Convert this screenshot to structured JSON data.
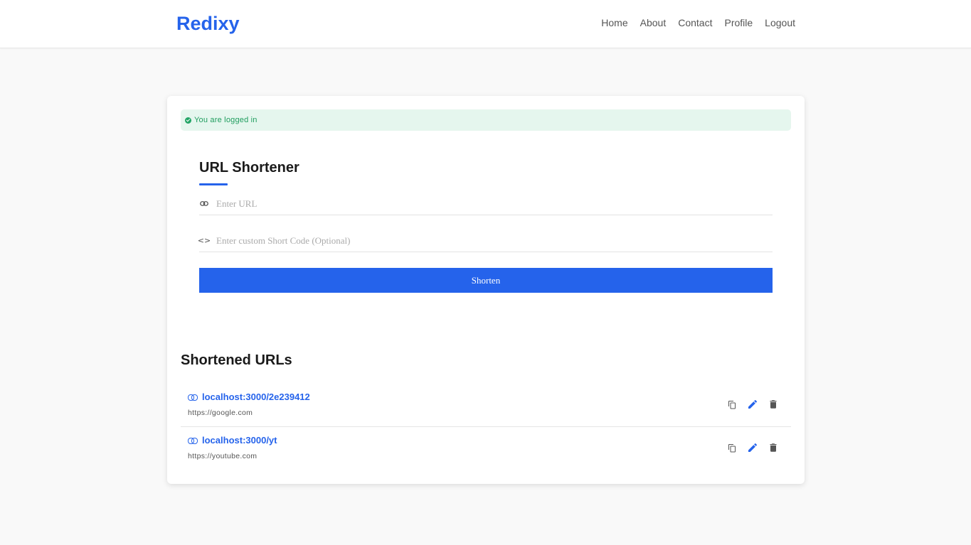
{
  "header": {
    "brand": "Redixy",
    "nav": [
      "Home",
      "About",
      "Contact",
      "Profile",
      "Logout"
    ]
  },
  "alert": {
    "text": "You are logged in",
    "icon": "check-circle-icon",
    "color": "#1f9d5e"
  },
  "form": {
    "title": "URL Shortener",
    "url_placeholder": "Enter URL",
    "url_icon": "link-icon",
    "code_placeholder": "Enter custom Short Code (Optional)",
    "code_icon": "code-icon",
    "code_icon_glyph": "<>",
    "submit_label": "Shorten"
  },
  "list": {
    "title": "Shortened URLs",
    "items": [
      {
        "short": "localhost:3000/2e239412",
        "original": "https://google.com"
      },
      {
        "short": "localhost:3000/yt",
        "original": "https://youtube.com"
      }
    ],
    "actions": [
      "copy-icon",
      "edit-icon",
      "delete-icon"
    ]
  },
  "colors": {
    "accent": "#2563eb",
    "alert_bg": "#e5f6ee",
    "page_bg": "#f9f9f9"
  }
}
